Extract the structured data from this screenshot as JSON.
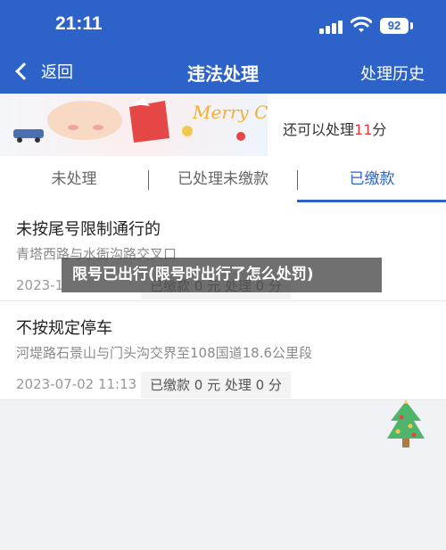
{
  "status": {
    "time": "21:11",
    "battery": "92"
  },
  "nav": {
    "back_label": "返回",
    "title": "违法处理",
    "history_label": "处理历史"
  },
  "banner": {
    "text_prefix": "还可以处理",
    "points": "11",
    "text_suffix": "分",
    "art_text": "Merry Chris"
  },
  "tabs": [
    {
      "label": "未处理",
      "active": false
    },
    {
      "label": "已处理未缴款",
      "active": false
    },
    {
      "label": "已缴款",
      "active": true
    }
  ],
  "records": [
    {
      "title": "未按尾号限制通行的",
      "location": "青塔西路与水衙沟路交叉口",
      "datetime": "2023-1",
      "status": "已缴款 0 元  处理 0 分"
    },
    {
      "title": "不按规定停车",
      "location": "河堤路石景山与门头沟交界至108国道18.6公里段",
      "datetime": "2023-07-02 11:13",
      "status": "已缴款 0 元  处理 0 分"
    }
  ],
  "overlay_caption": "限号已出行(限号时出行了怎么处罚)",
  "colors": {
    "primary": "#2d63c8",
    "accent_red": "#e33b3b"
  },
  "icons": [
    "signal-icon",
    "wifi-icon",
    "battery-icon",
    "back-chevron-icon",
    "christmas-tree-icon"
  ]
}
